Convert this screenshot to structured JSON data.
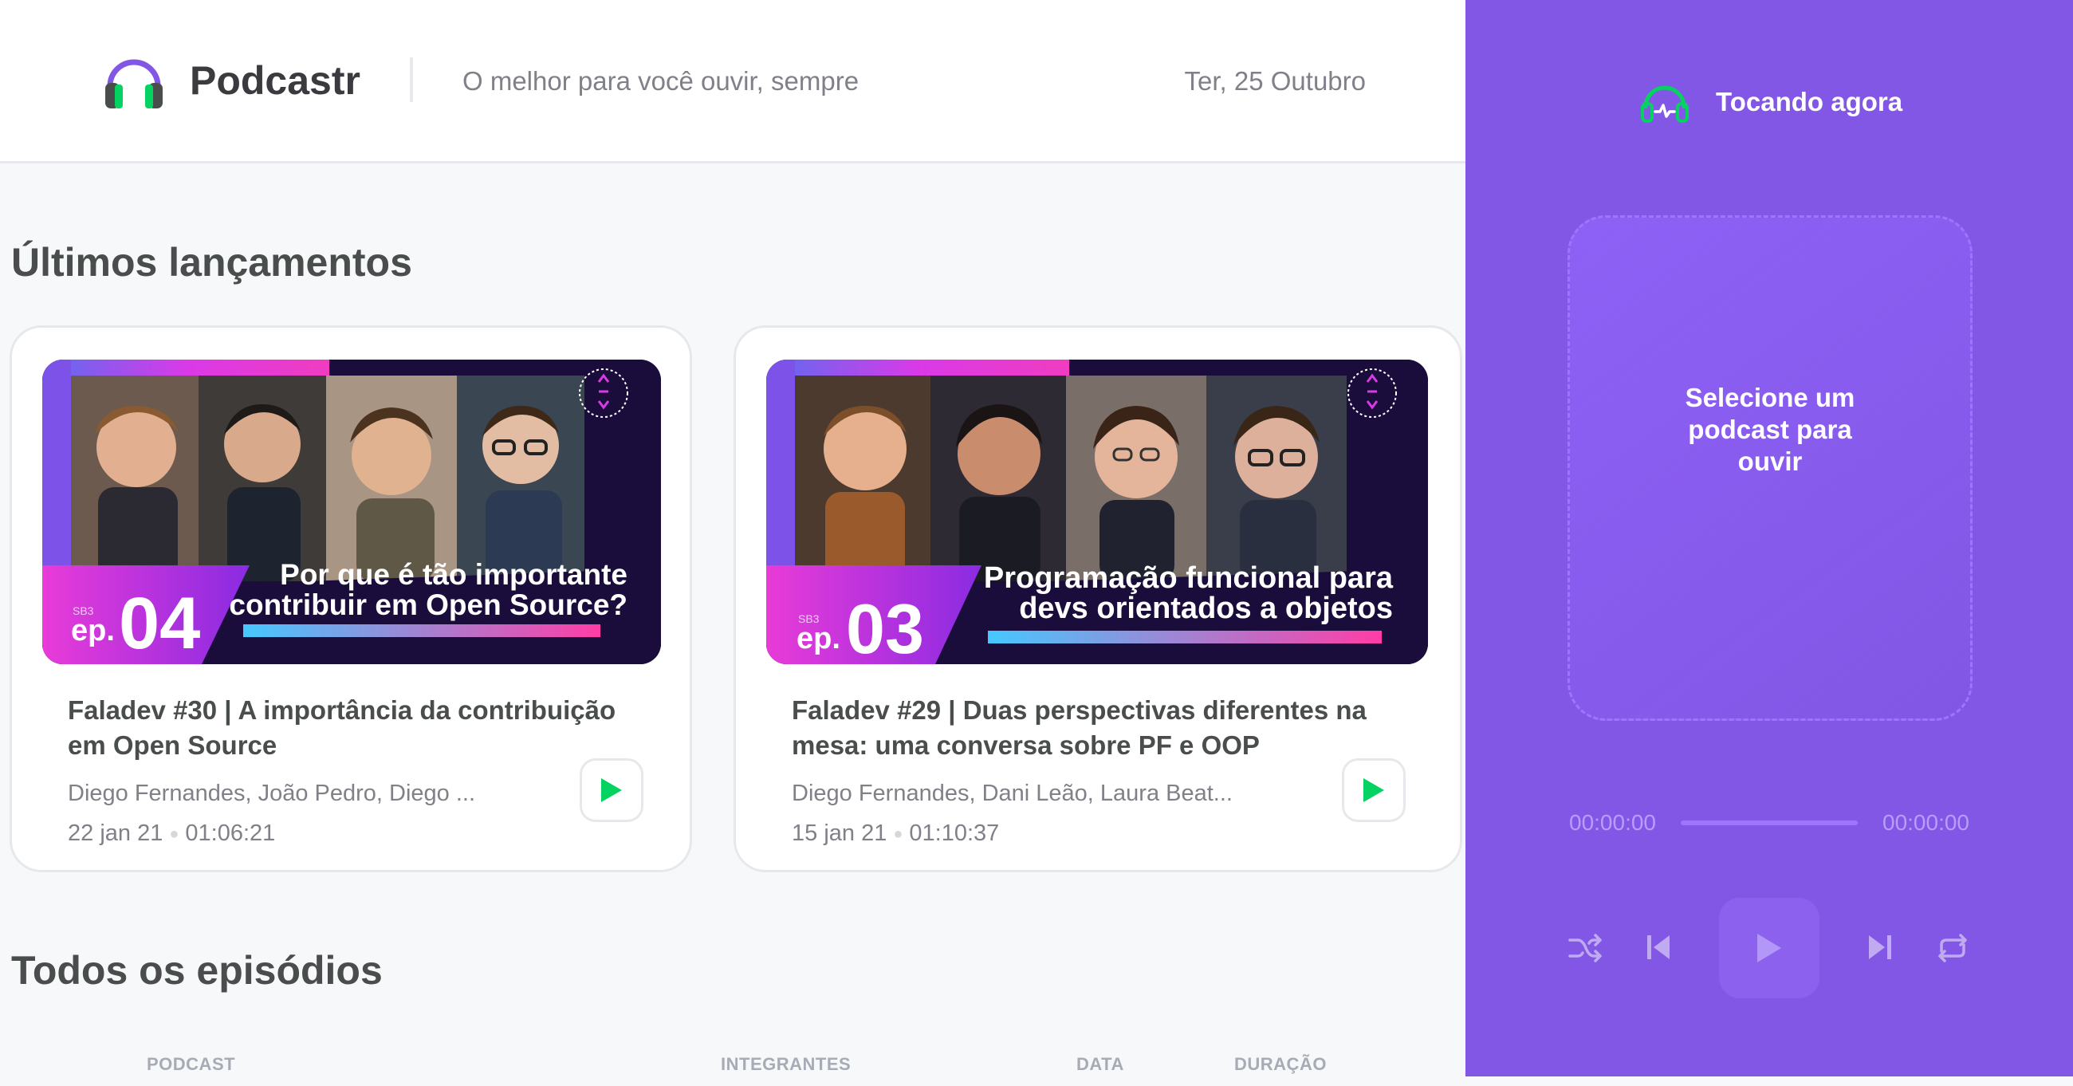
{
  "header": {
    "brand": "Podcastr",
    "tagline": "O melhor para você ouvir, sempre",
    "date": "Ter, 25 Outubro"
  },
  "latest": {
    "title": "Últimos lançamentos",
    "episodes": [
      {
        "title": "Faladev #30 | A importância da contribuição em Open Source",
        "members": "Diego Fernandes, João Pedro, Diego ...",
        "date": "22 jan 21",
        "duration": "01:06:21",
        "thumb": {
          "ep_prefix": "ep.",
          "ep_number": "04",
          "season": "SB3",
          "line1": "Por que é tão importante",
          "line2": "contribuir em Open Source?"
        }
      },
      {
        "title": "Faladev #29 | Duas perspectivas diferentes na mesa: uma conversa sobre PF e OOP",
        "members": "Diego Fernandes, Dani Leão, Laura Beat...",
        "date": "15 jan 21",
        "duration": "01:10:37",
        "thumb": {
          "ep_prefix": "ep.",
          "ep_number": "03",
          "season": "SB3",
          "line1": "Programação funcional para",
          "line2": "devs orientados a objetos"
        }
      }
    ]
  },
  "all": {
    "title": "Todos os episódios",
    "columns": [
      "PODCAST",
      "INTEGRANTES",
      "DATA",
      "DURAÇÃO"
    ]
  },
  "player": {
    "label": "Tocando agora",
    "empty_message": "Selecione um podcast para ouvir",
    "current_time": "00:00:00",
    "total_time": "00:00:00",
    "progress": 0
  },
  "colors": {
    "purple": "#8257e5",
    "green": "#04d361",
    "text_dark": "#494d4b",
    "text_muted": "#808089"
  }
}
